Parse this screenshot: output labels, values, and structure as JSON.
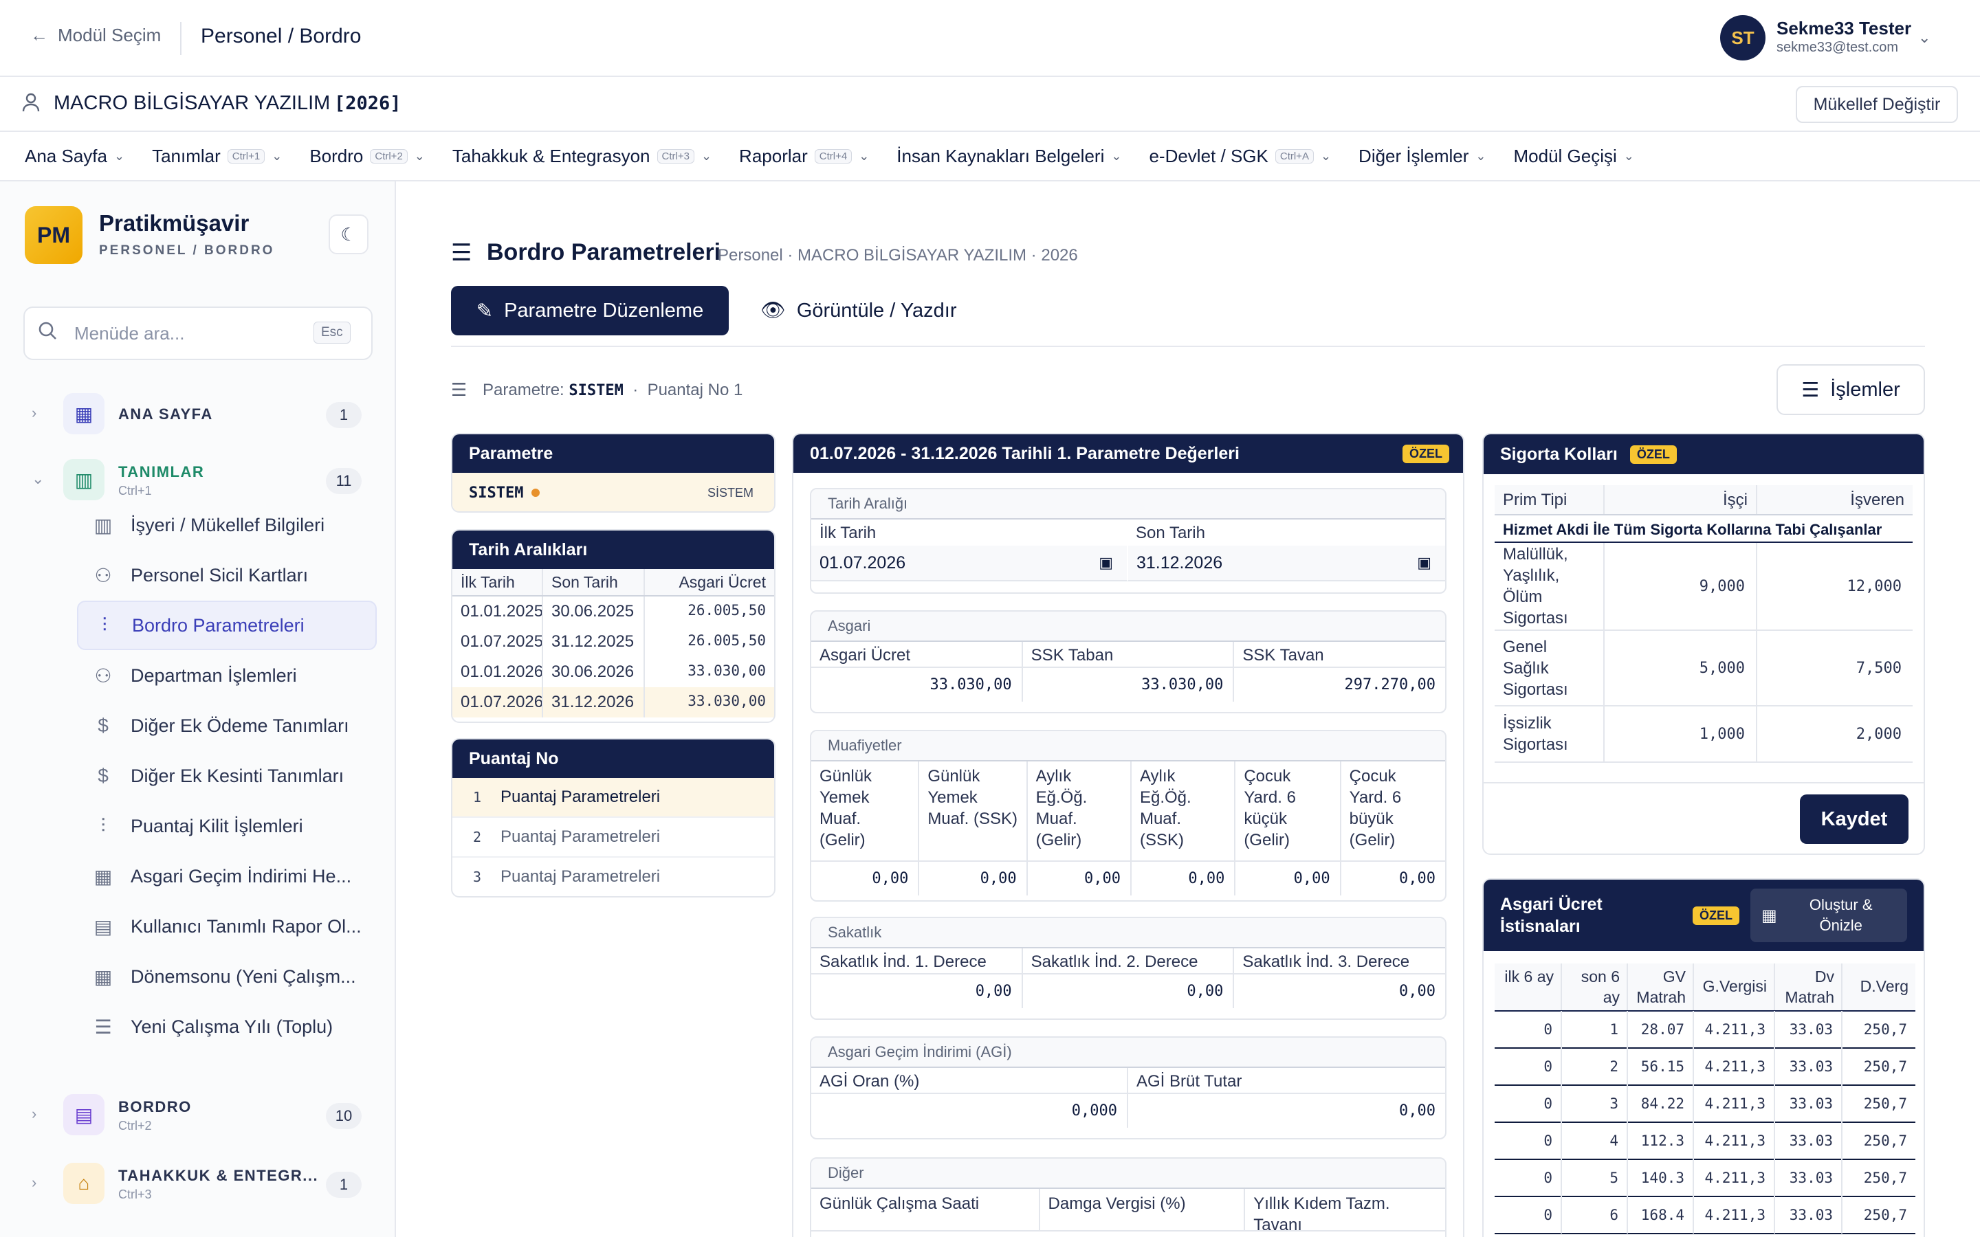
{
  "topbar": {
    "back_label": "Modül Seçim",
    "breadcrumb": "Personel / Bordro",
    "user_initials": "ST",
    "user_name": "Sekme33 Tester",
    "user_email": "sekme33@test.com"
  },
  "company": {
    "name": "MACRO BİLGİSAYAR YAZILIM",
    "year": "[2026]",
    "change_button": "Mükellef Değiştir"
  },
  "menu": [
    {
      "label": "Ana Sayfa",
      "kbd": ""
    },
    {
      "label": "Tanımlar",
      "kbd": "Ctrl+1"
    },
    {
      "label": "Bordro",
      "kbd": "Ctrl+2"
    },
    {
      "label": "Tahakkuk & Entegrasyon",
      "kbd": "Ctrl+3"
    },
    {
      "label": "Raporlar",
      "kbd": "Ctrl+4"
    },
    {
      "label": "İnsan Kaynakları Belgeleri",
      "kbd": ""
    },
    {
      "label": "e-Devlet / SGK",
      "kbd": "Ctrl+A"
    },
    {
      "label": "Diğer İşlemler",
      "kbd": ""
    },
    {
      "label": "Modül Geçişi",
      "kbd": ""
    }
  ],
  "sidebar": {
    "logo": "PM",
    "brand": "Pratikmüşavir",
    "brand_sub": "PERSONEL / BORDRO",
    "search_placeholder": "Menüde ara...",
    "search_kbd": "Esc",
    "groups": [
      {
        "title": "ANA SAYFA",
        "sub": "",
        "count": "1"
      },
      {
        "title": "TANIMLAR",
        "sub": "Ctrl+1",
        "count": "11"
      },
      {
        "title": "BORDRO",
        "sub": "Ctrl+2",
        "count": "10"
      },
      {
        "title": "TAHAKKUK & ENTEGR...",
        "sub": "Ctrl+3",
        "count": "1"
      }
    ],
    "items": [
      {
        "label": "İşyeri / Mükellef Bilgileri",
        "icon": "building-icon"
      },
      {
        "label": "Personel Sicil Kartları",
        "icon": "users-icon"
      },
      {
        "label": "Bordro Parametreleri",
        "icon": "sliders-icon"
      },
      {
        "label": "Departman İşlemleri",
        "icon": "user-cog-icon"
      },
      {
        "label": "Diğer Ek Ödeme Tanımları",
        "icon": "dollar-circle-icon"
      },
      {
        "label": "Diğer Ek Kesinti Tanımları",
        "icon": "dollar-circle-icon"
      },
      {
        "label": "Puantaj Kilit İşlemleri",
        "icon": "sliders-icon"
      },
      {
        "label": "Asgari Geçim İndirimi He...",
        "icon": "calculator-icon"
      },
      {
        "label": "Kullanıcı Tanımlı Rapor Ol...",
        "icon": "file-icon"
      },
      {
        "label": "Dönemsonu (Yeni Çalışm...",
        "icon": "calendar-icon"
      },
      {
        "label": "Yeni Çalışma Yılı (Toplu)",
        "icon": "list-check-icon"
      }
    ]
  },
  "page": {
    "title": "Bordro Parametreleri",
    "subtitle": "Personel · MACRO BİLGİSAYAR YAZILIM · 2026",
    "tab_edit": "Parametre Düzenleme",
    "tab_view": "Görüntüle / Yazdır",
    "param_prefix": "Parametre:",
    "param_value": "SISTEM",
    "param_sep": "·",
    "puantaj_label": "Puantaj No 1",
    "ops_button": "İşlemler"
  },
  "parametre_card": {
    "title": "Parametre",
    "value": "SISTEM",
    "tag": "SİSTEM"
  },
  "tarih_card": {
    "title": "Tarih Aralıkları",
    "headers": [
      "İlk Tarih",
      "Son Tarih",
      "Asgari Ücret"
    ],
    "rows": [
      [
        "01.01.2025",
        "30.06.2025",
        "26.005,50"
      ],
      [
        "01.07.2025",
        "31.12.2025",
        "26.005,50"
      ],
      [
        "01.01.2026",
        "30.06.2026",
        "33.030,00"
      ],
      [
        "01.07.2026",
        "31.12.2026",
        "33.030,00"
      ]
    ]
  },
  "puantaj_card": {
    "title": "Puantaj No",
    "rows": [
      [
        "1",
        "Puantaj Parametreleri"
      ],
      [
        "2",
        "Puantaj Parametreleri"
      ],
      [
        "3",
        "Puantaj Parametreleri"
      ]
    ]
  },
  "values_card": {
    "title": "01.07.2026 - 31.12.2026 Tarihli 1. Parametre Değerleri",
    "badge": "ÖZEL",
    "tarih": {
      "title": "Tarih Aralığı",
      "h1": "İlk Tarih",
      "h2": "Son Tarih",
      "v1": "01.07.2026",
      "v2": "31.12.2026"
    },
    "asgari": {
      "title": "Asgari",
      "headers": [
        "Asgari Ücret",
        "SSK Taban",
        "SSK Tavan"
      ],
      "values": [
        "33.030,00",
        "33.030,00",
        "297.270,00"
      ]
    },
    "muaf": {
      "title": "Muafiyetler",
      "headers": [
        "Günlük Yemek Muaf. (Gelir)",
        "Günlük Yemek Muaf. (SSK)",
        "Aylık Eğ.Öğ. Muaf. (Gelir)",
        "Aylık Eğ.Öğ. Muaf. (SSK)",
        "Çocuk Yard. 6 küçük (Gelir)",
        "Çocuk Yard. 6 büyük (Gelir)"
      ],
      "values": [
        "0,00",
        "0,00",
        "0,00",
        "0,00",
        "0,00",
        "0,00"
      ]
    },
    "sakat": {
      "title": "Sakatlık",
      "headers": [
        "Sakatlık İnd. 1. Derece",
        "Sakatlık İnd. 2. Derece",
        "Sakatlık İnd. 3. Derece"
      ],
      "values": [
        "0,00",
        "0,00",
        "0,00"
      ]
    },
    "agi": {
      "title": "Asgari Geçim İndirimi (AGİ)",
      "headers": [
        "AGİ Oran (%)",
        "AGİ Brüt Tutar"
      ],
      "values": [
        "0,000",
        "0,00"
      ]
    },
    "diger": {
      "title": "Diğer",
      "headers": [
        "Günlük Çalışma Saati",
        "Damga Vergisi (%)",
        "Yıllık Kıdem Tazm. Tavanı"
      ]
    }
  },
  "sigorta_card": {
    "title": "Sigorta Kolları",
    "badge": "ÖZEL",
    "headers": [
      "Prim Tipi",
      "İşçi",
      "İşveren"
    ],
    "group": "Hizmet Akdi İle Tüm Sigorta Kollarına Tabi Çalışanlar",
    "rows": [
      [
        "Malüllük, Yaşlılık, Ölüm Sigortası",
        "9,000",
        "12,000"
      ],
      [
        "Genel Sağlık Sigortası",
        "5,000",
        "7,500"
      ],
      [
        "İşsizlik Sigortası",
        "1,000",
        "2,000"
      ]
    ],
    "save": "Kaydet"
  },
  "istisna_card": {
    "title": "Asgari Ücret İstisnaları",
    "badge": "ÖZEL",
    "button": "Oluştur & Önizle",
    "headers": [
      "ilk 6 ay",
      "son 6 ay",
      "GV Matrah",
      "G.Vergisi",
      "Dv Matrah",
      "D.Verg"
    ],
    "rows": [
      [
        "0",
        "1",
        "28.07",
        "4.211,3",
        "33.03",
        "250,7"
      ],
      [
        "0",
        "2",
        "56.15",
        "4.211,3",
        "33.03",
        "250,7"
      ],
      [
        "0",
        "3",
        "84.22",
        "4.211,3",
        "33.03",
        "250,7"
      ],
      [
        "0",
        "4",
        "112.3",
        "4.211,3",
        "33.03",
        "250,7"
      ],
      [
        "0",
        "5",
        "140.3",
        "4.211,3",
        "33.03",
        "250,7"
      ],
      [
        "0",
        "6",
        "168.4",
        "4.211,3",
        "33.03",
        "250,7"
      ]
    ]
  },
  "colors": {
    "navy": "#14204a",
    "accent": "#f7c531",
    "active": "#3b3fb8"
  }
}
